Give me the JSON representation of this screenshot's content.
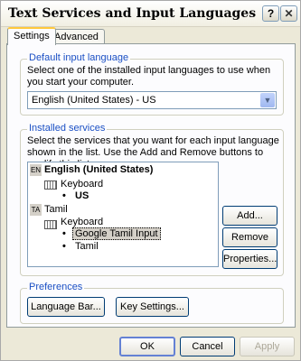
{
  "window": {
    "title": "Text Services and Input Languages"
  },
  "titlebar": {
    "help_label": "?",
    "close_label": "✕"
  },
  "tabs": [
    {
      "label": "Settings",
      "active": true
    },
    {
      "label": "Advanced",
      "active": false
    }
  ],
  "default_language": {
    "group_label": "Default input language",
    "description": "Select one of the installed input languages to use when you start your computer.",
    "selected": "English (United States) - US",
    "dropdown_icon": "chevron-down-icon"
  },
  "installed_services": {
    "group_label": "Installed services",
    "description": "Select the services that you want for each input language shown in the list. Use the Add and Remove buttons to modify this list.",
    "tree": {
      "lang1": {
        "code": "EN",
        "name": "English (United States)",
        "category": "Keyboard",
        "item": "US"
      },
      "lang2": {
        "code": "TA",
        "name": "Tamil",
        "category": "Keyboard",
        "items": [
          "Google Tamil Input",
          "Tamil"
        ]
      }
    },
    "buttons": {
      "add": "Add...",
      "remove": "Remove",
      "properties": "Properties..."
    }
  },
  "preferences": {
    "group_label": "Preferences",
    "language_bar": "Language Bar...",
    "key_settings": "Key Settings..."
  },
  "dialog_buttons": {
    "ok": "OK",
    "cancel": "Cancel",
    "apply": "Apply"
  }
}
